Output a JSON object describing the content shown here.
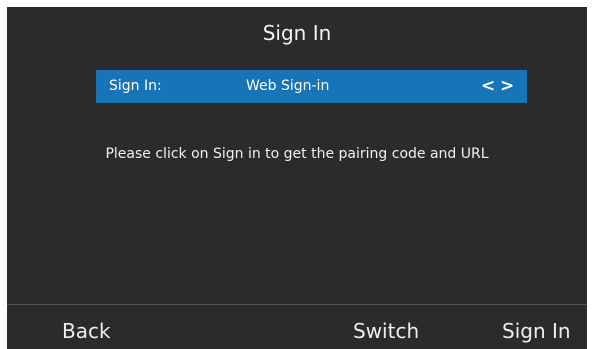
{
  "screen": {
    "title": "Sign In",
    "background": "#2b2b2b"
  },
  "selector": {
    "label": "Sign In:",
    "value": "Web Sign-in",
    "left_arrow": "<",
    "right_arrow": ">",
    "highlight_color": "#1774b6"
  },
  "message": "Please click on Sign in to get the pairing code and URL",
  "softkeys": {
    "back": "Back",
    "switch": "Switch",
    "sign_in": "Sign In"
  },
  "icons": [
    "chevron-left-icon",
    "chevron-right-icon"
  ]
}
